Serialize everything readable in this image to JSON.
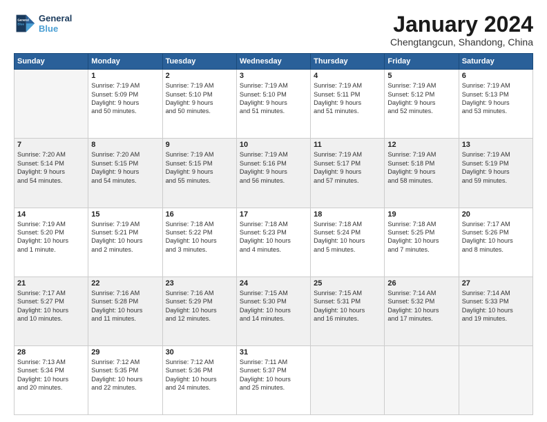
{
  "logo": {
    "line1": "General",
    "line2": "Blue"
  },
  "title": "January 2024",
  "subtitle": "Chengtangcun, Shandong, China",
  "days_header": [
    "Sunday",
    "Monday",
    "Tuesday",
    "Wednesday",
    "Thursday",
    "Friday",
    "Saturday"
  ],
  "weeks": [
    [
      {
        "num": "",
        "info": ""
      },
      {
        "num": "1",
        "info": "Sunrise: 7:19 AM\nSunset: 5:09 PM\nDaylight: 9 hours\nand 50 minutes."
      },
      {
        "num": "2",
        "info": "Sunrise: 7:19 AM\nSunset: 5:10 PM\nDaylight: 9 hours\nand 50 minutes."
      },
      {
        "num": "3",
        "info": "Sunrise: 7:19 AM\nSunset: 5:10 PM\nDaylight: 9 hours\nand 51 minutes."
      },
      {
        "num": "4",
        "info": "Sunrise: 7:19 AM\nSunset: 5:11 PM\nDaylight: 9 hours\nand 51 minutes."
      },
      {
        "num": "5",
        "info": "Sunrise: 7:19 AM\nSunset: 5:12 PM\nDaylight: 9 hours\nand 52 minutes."
      },
      {
        "num": "6",
        "info": "Sunrise: 7:19 AM\nSunset: 5:13 PM\nDaylight: 9 hours\nand 53 minutes."
      }
    ],
    [
      {
        "num": "7",
        "info": "Sunrise: 7:20 AM\nSunset: 5:14 PM\nDaylight: 9 hours\nand 54 minutes."
      },
      {
        "num": "8",
        "info": "Sunrise: 7:20 AM\nSunset: 5:15 PM\nDaylight: 9 hours\nand 54 minutes."
      },
      {
        "num": "9",
        "info": "Sunrise: 7:19 AM\nSunset: 5:15 PM\nDaylight: 9 hours\nand 55 minutes."
      },
      {
        "num": "10",
        "info": "Sunrise: 7:19 AM\nSunset: 5:16 PM\nDaylight: 9 hours\nand 56 minutes."
      },
      {
        "num": "11",
        "info": "Sunrise: 7:19 AM\nSunset: 5:17 PM\nDaylight: 9 hours\nand 57 minutes."
      },
      {
        "num": "12",
        "info": "Sunrise: 7:19 AM\nSunset: 5:18 PM\nDaylight: 9 hours\nand 58 minutes."
      },
      {
        "num": "13",
        "info": "Sunrise: 7:19 AM\nSunset: 5:19 PM\nDaylight: 9 hours\nand 59 minutes."
      }
    ],
    [
      {
        "num": "14",
        "info": "Sunrise: 7:19 AM\nSunset: 5:20 PM\nDaylight: 10 hours\nand 1 minute."
      },
      {
        "num": "15",
        "info": "Sunrise: 7:19 AM\nSunset: 5:21 PM\nDaylight: 10 hours\nand 2 minutes."
      },
      {
        "num": "16",
        "info": "Sunrise: 7:18 AM\nSunset: 5:22 PM\nDaylight: 10 hours\nand 3 minutes."
      },
      {
        "num": "17",
        "info": "Sunrise: 7:18 AM\nSunset: 5:23 PM\nDaylight: 10 hours\nand 4 minutes."
      },
      {
        "num": "18",
        "info": "Sunrise: 7:18 AM\nSunset: 5:24 PM\nDaylight: 10 hours\nand 5 minutes."
      },
      {
        "num": "19",
        "info": "Sunrise: 7:18 AM\nSunset: 5:25 PM\nDaylight: 10 hours\nand 7 minutes."
      },
      {
        "num": "20",
        "info": "Sunrise: 7:17 AM\nSunset: 5:26 PM\nDaylight: 10 hours\nand 8 minutes."
      }
    ],
    [
      {
        "num": "21",
        "info": "Sunrise: 7:17 AM\nSunset: 5:27 PM\nDaylight: 10 hours\nand 10 minutes."
      },
      {
        "num": "22",
        "info": "Sunrise: 7:16 AM\nSunset: 5:28 PM\nDaylight: 10 hours\nand 11 minutes."
      },
      {
        "num": "23",
        "info": "Sunrise: 7:16 AM\nSunset: 5:29 PM\nDaylight: 10 hours\nand 12 minutes."
      },
      {
        "num": "24",
        "info": "Sunrise: 7:15 AM\nSunset: 5:30 PM\nDaylight: 10 hours\nand 14 minutes."
      },
      {
        "num": "25",
        "info": "Sunrise: 7:15 AM\nSunset: 5:31 PM\nDaylight: 10 hours\nand 16 minutes."
      },
      {
        "num": "26",
        "info": "Sunrise: 7:14 AM\nSunset: 5:32 PM\nDaylight: 10 hours\nand 17 minutes."
      },
      {
        "num": "27",
        "info": "Sunrise: 7:14 AM\nSunset: 5:33 PM\nDaylight: 10 hours\nand 19 minutes."
      }
    ],
    [
      {
        "num": "28",
        "info": "Sunrise: 7:13 AM\nSunset: 5:34 PM\nDaylight: 10 hours\nand 20 minutes."
      },
      {
        "num": "29",
        "info": "Sunrise: 7:12 AM\nSunset: 5:35 PM\nDaylight: 10 hours\nand 22 minutes."
      },
      {
        "num": "30",
        "info": "Sunrise: 7:12 AM\nSunset: 5:36 PM\nDaylight: 10 hours\nand 24 minutes."
      },
      {
        "num": "31",
        "info": "Sunrise: 7:11 AM\nSunset: 5:37 PM\nDaylight: 10 hours\nand 25 minutes."
      },
      {
        "num": "",
        "info": ""
      },
      {
        "num": "",
        "info": ""
      },
      {
        "num": "",
        "info": ""
      }
    ]
  ]
}
